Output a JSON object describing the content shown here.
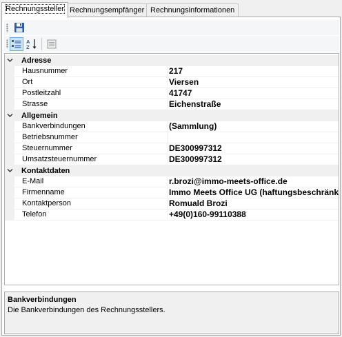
{
  "tabs": [
    {
      "label": "Rechnungssteller",
      "active": true
    },
    {
      "label": "Rechnungsempfänger",
      "active": false
    },
    {
      "label": "Rechnungsinformationen",
      "active": false
    }
  ],
  "toolbar": {
    "save_icon": "floppy-disk-icon",
    "categorized_icon": "categorized-view-icon",
    "alphabetical_icon": "alphabetical-sort-icon",
    "property_pages_icon": "property-pages-icon"
  },
  "grid": {
    "categories": [
      {
        "name": "Adresse",
        "properties": [
          {
            "name": "Hausnummer",
            "value": "217"
          },
          {
            "name": "Ort",
            "value": "Viersen"
          },
          {
            "name": "Postleitzahl",
            "value": "41747"
          },
          {
            "name": "Strasse",
            "value": "Eichenstraße"
          }
        ]
      },
      {
        "name": "Allgemein",
        "properties": [
          {
            "name": "Bankverbindungen",
            "value": "(Sammlung)"
          },
          {
            "name": "Betriebsnummer",
            "value": ""
          },
          {
            "name": "Steuernummer",
            "value": "DE300997312"
          },
          {
            "name": "Umsatzsteuernummer",
            "value": "DE300997312"
          }
        ]
      },
      {
        "name": "Kontaktdaten",
        "properties": [
          {
            "name": "E-Mail",
            "value": "r.brozi@immo-meets-office.de"
          },
          {
            "name": "Firmenname",
            "value": "Immo Meets Office UG (haftungsbeschränkt"
          },
          {
            "name": "Kontaktperson",
            "value": "Romuald Brozi"
          },
          {
            "name": "Telefon",
            "value": "+49(0)160-99110388"
          }
        ]
      }
    ]
  },
  "description": {
    "title": "Bankverbindungen",
    "text": "Die Bankverbindungen des Rechnungsstellers."
  }
}
